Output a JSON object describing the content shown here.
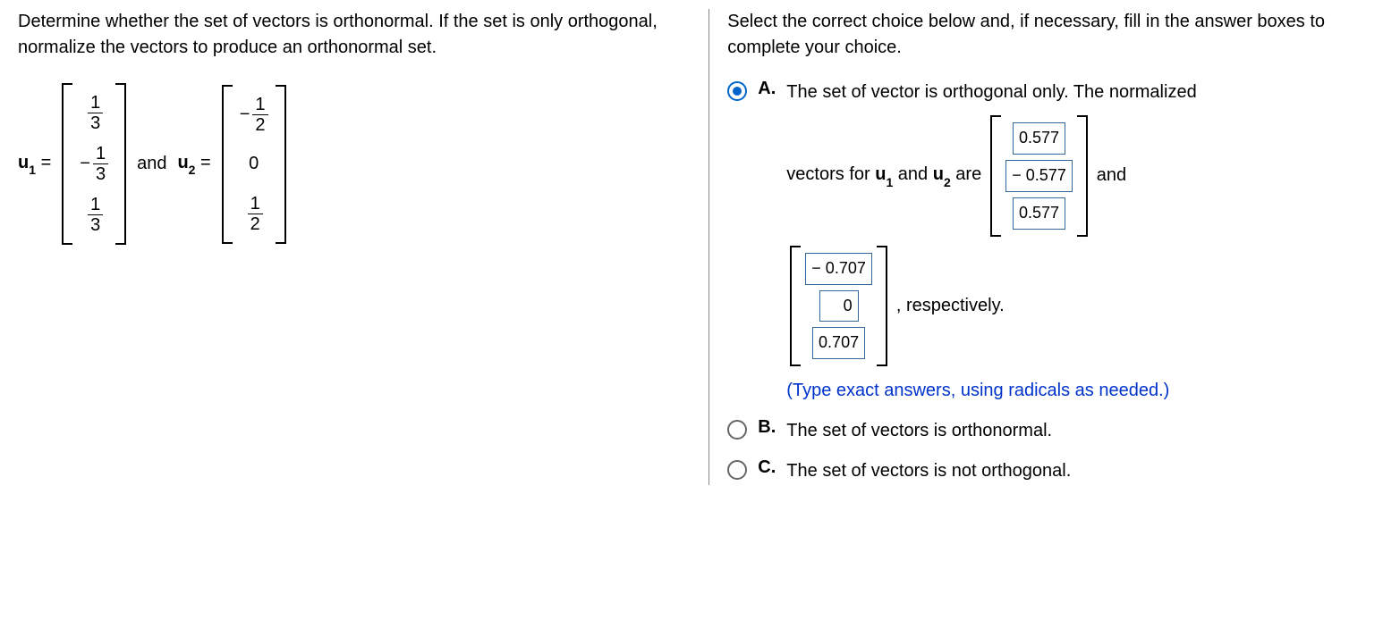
{
  "left": {
    "question": "Determine whether the set of vectors is orthonormal. If the set is only orthogonal, normalize the vectors to produce an orthonormal set.",
    "u1": {
      "label": "u",
      "sub": "1",
      "eq": " =",
      "entries": [
        [
          "",
          "1",
          "3"
        ],
        [
          "−",
          "1",
          "3"
        ],
        [
          "",
          "1",
          "3"
        ]
      ]
    },
    "and": "and",
    "u2": {
      "label": "u",
      "sub": "2",
      "eq": " =",
      "entries": [
        [
          "−",
          "1",
          "2"
        ],
        [
          "",
          "0",
          ""
        ],
        [
          "",
          "1",
          "2"
        ]
      ]
    }
  },
  "right": {
    "instruction": "Select the correct choice below and, if necessary, fill in the answer boxes to complete your choice.",
    "choices": {
      "a": {
        "letter": "A.",
        "text1": "The set of vector is orthogonal only. The normalized",
        "text2_pre": "vectors for ",
        "u1_label": "u",
        "u1_sub": "1",
        "and": " and ",
        "u2_label": "u",
        "u2_sub": "2",
        "are": " are ",
        "vec1": [
          "0.577",
          "− 0.577",
          "0.577"
        ],
        "and2": " and",
        "vec2": [
          "− 0.707",
          "0",
          "0.707"
        ],
        "resp": ", respectively.",
        "hint": "(Type exact answers, using radicals as needed.)"
      },
      "b": {
        "letter": "B.",
        "text": "The set of vectors is orthonormal."
      },
      "c": {
        "letter": "C.",
        "text": "The set of vectors is not orthogonal."
      }
    }
  }
}
